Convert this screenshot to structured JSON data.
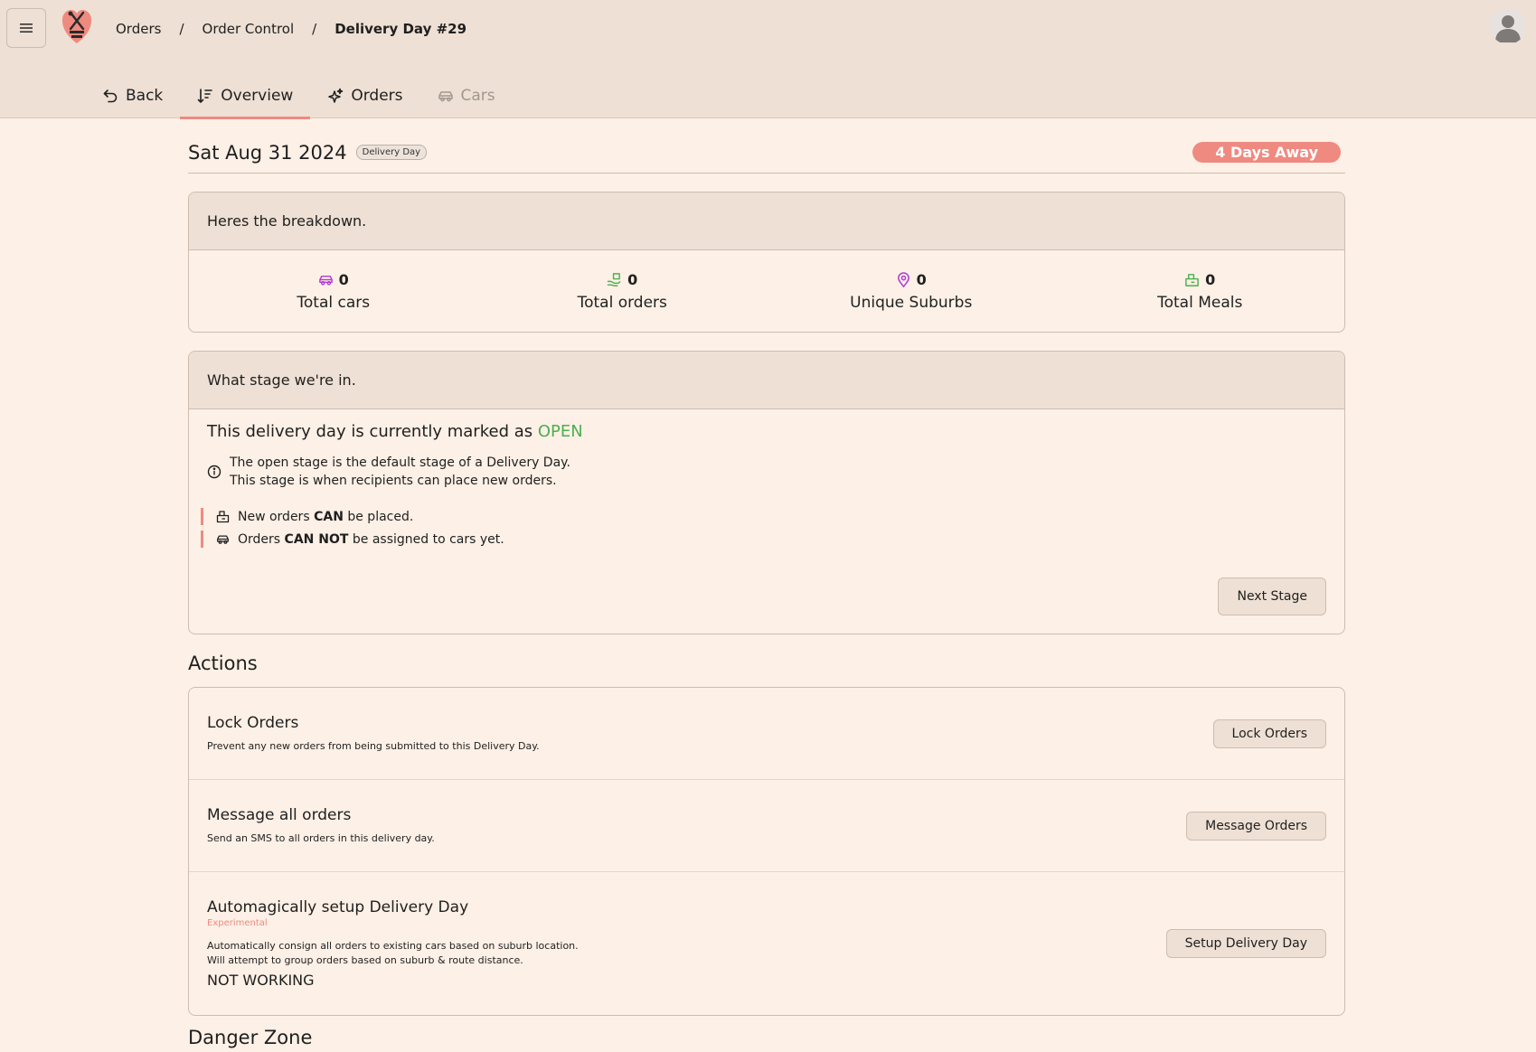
{
  "topbar": {
    "breadcrumb": [
      "Orders",
      "Order Control",
      "Delivery Day #29"
    ],
    "breadcrumb_separator": "/"
  },
  "tabs": [
    {
      "label": "Back",
      "icon": "back-arrow-icon"
    },
    {
      "label": "Overview",
      "icon": "sort-icon",
      "active": true
    },
    {
      "label": "Orders",
      "icon": "sparkle-icon"
    },
    {
      "label": "Cars",
      "icon": "car-icon",
      "disabled": true
    }
  ],
  "header": {
    "date": "Sat Aug 31 2024",
    "type_badge": "Delivery Day",
    "countdown": "4 Days Away"
  },
  "breakdown": {
    "title": "Heres the breakdown.",
    "stats": [
      {
        "value": "0",
        "label": "Total cars",
        "icon": "car-icon",
        "color": "#b03ad6"
      },
      {
        "value": "0",
        "label": "Total orders",
        "icon": "hand-box-icon",
        "color": "#4caf50"
      },
      {
        "value": "0",
        "label": "Unique Suburbs",
        "icon": "map-pin-icon",
        "color": "#b03ad6"
      },
      {
        "value": "0",
        "label": "Total Meals",
        "icon": "meal-box-icon",
        "color": "#4caf50"
      }
    ]
  },
  "stage": {
    "title": "What stage we're in.",
    "status_prefix": "This delivery day is currently marked as",
    "status": "OPEN",
    "info_line1": "The open stage is the default stage of a Delivery Day.",
    "info_line2": "This stage is when recipients can place new orders.",
    "rules": [
      {
        "before": "New orders",
        "bold": "CAN",
        "after": "be placed."
      },
      {
        "before": "Orders",
        "bold": "CAN NOT",
        "after": "be assigned to cars yet."
      }
    ],
    "next_button": "Next Stage"
  },
  "actions": {
    "title": "Actions",
    "items": [
      {
        "title": "Lock Orders",
        "desc": "Prevent any new orders from being submitted to this Delivery Day.",
        "button": "Lock Orders"
      },
      {
        "title": "Message all orders",
        "desc": "Send an SMS to all orders in this delivery day.",
        "button": "Message Orders"
      },
      {
        "title": "Automagically setup Delivery Day",
        "tag": "Experimental",
        "desc1": "Automatically consign all orders to existing cars based on suburb location.",
        "desc2": "Will attempt to group orders based on suburb & route distance.",
        "note": "NOT WORKING",
        "button": "Setup Delivery Day"
      }
    ]
  },
  "danger": {
    "title": "Danger Zone"
  },
  "colors": {
    "accent": "#ef8a80",
    "open_status": "#4caf50",
    "topbar": "#eee0d4",
    "page": "#fdf0e6"
  }
}
